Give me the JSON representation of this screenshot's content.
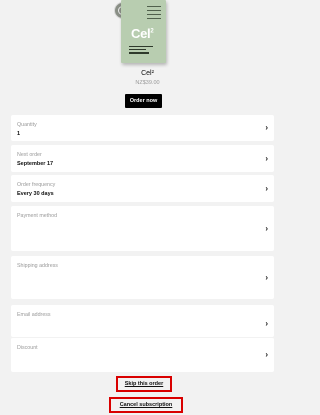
{
  "product": {
    "box_brand": "Cel",
    "box_brand_sup": "2",
    "name": "Cel²",
    "price": "NZ$39.00",
    "order_now_label": "Order now"
  },
  "fields": [
    {
      "label": "Quantity",
      "value": "1"
    },
    {
      "label": "Next order",
      "value": "September 17"
    },
    {
      "label": "Order frequency",
      "value": "Every 30 days"
    },
    {
      "label": "Payment method",
      "value": ""
    },
    {
      "label": "Shipping address",
      "value": ""
    },
    {
      "label": "Email address",
      "value": ""
    },
    {
      "label": "Discount",
      "value": ""
    }
  ],
  "chevron": "›",
  "links": {
    "skip": "Skip this order",
    "cancel": "Cancel subscription"
  },
  "colors": {
    "page_bg": "#f2f2f2",
    "card_bg": "#ffffff",
    "button_bg": "#000000",
    "highlight_border": "#d90000",
    "box_green": "#b8cdb0"
  }
}
